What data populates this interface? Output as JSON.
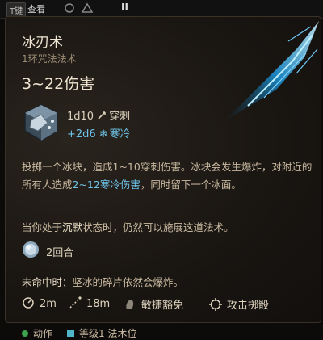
{
  "top_bar": {
    "key_hint": "T键",
    "view_label": "查看",
    "pause_icon": "pause-icon"
  },
  "spell": {
    "name": "冰刃术",
    "subtitle": "1环咒法法术",
    "damage_total": "3~22伤害",
    "damage_dice_1": "1d10",
    "damage_type_1": "穿刺",
    "damage_dice_2": "+2d6",
    "damage_type_2": "寒冷",
    "desc_part1": "投掷一个冰块，造成1~10穿刺伤害。冰块会发生爆炸，对附近的所有人造成",
    "desc_cold": "2~12寒冷伤害",
    "desc_part2": "，同时留下一个冰面。",
    "note_part1": "当你处于",
    "note_silence": "沉默",
    "note_part2": "状态时，仍然可以施展这道法术。",
    "duration": "2回合",
    "miss_label": "未命中时：",
    "miss_text": "坚冰的碎片依然会爆炸。",
    "range": "2m",
    "aoe": "18m",
    "save": "敏捷豁免",
    "roll": "攻击掷骰",
    "action_label": "动作",
    "slot_label": "等级1 法术位"
  },
  "colors": {
    "accent_cold": "#6ec3e8",
    "title": "#efe6d4",
    "subtitle": "#9c8d75",
    "action_dot": "#3fa34d",
    "slot_square": "#4fb6c9"
  },
  "icons": [
    "dice-icon",
    "pierce-icon",
    "snowflake-icon",
    "duration-icon",
    "range-icon",
    "aoe-icon",
    "dex-save-icon",
    "target-icon",
    "ice-knife-art"
  ]
}
